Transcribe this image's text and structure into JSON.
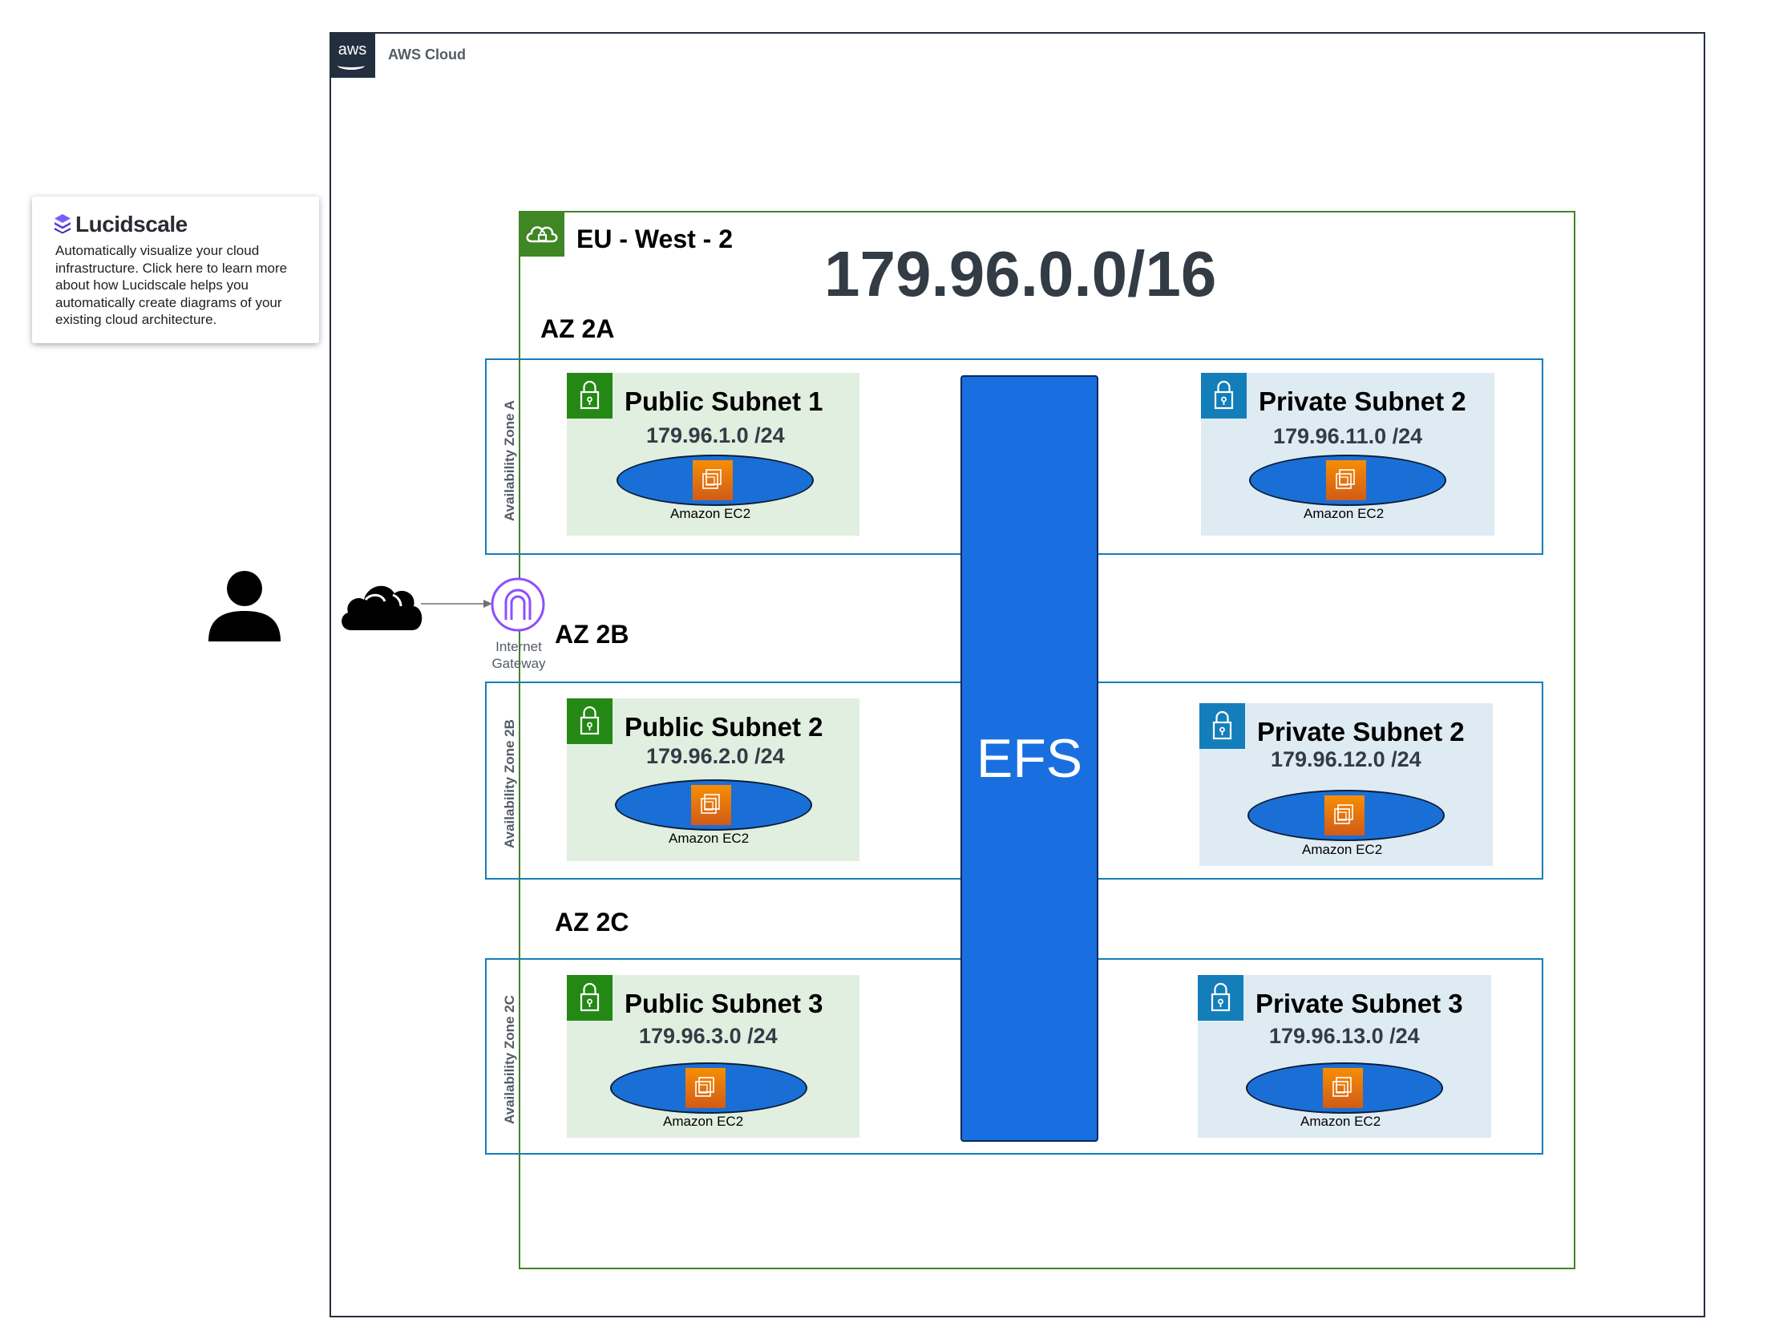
{
  "aws_cloud": {
    "label": "AWS Cloud",
    "logo_text": "aws"
  },
  "region": {
    "label": "EU - West - 2",
    "cidr": "179.96.0.0/16"
  },
  "lucidscale": {
    "name": "Lucidscale",
    "description": "Automatically visualize your cloud infrastructure. Click here to learn more about how Lucidscale helps you automatically create diagrams of your existing cloud architecture."
  },
  "internet_gateway": {
    "label": "Internet Gateway"
  },
  "efs": {
    "label": "EFS"
  },
  "zones": [
    {
      "az_label": "AZ 2A",
      "zone_label": "Availability Zone A",
      "public": {
        "title": "Public Subnet 1",
        "cidr": "179.96.1.0 /24",
        "ec2": "Amazon EC2"
      },
      "private": {
        "title": "Private Subnet 2",
        "cidr": "179.96.11.0 /24",
        "ec2": "Amazon EC2"
      }
    },
    {
      "az_label": "AZ 2B",
      "zone_label": "Availability Zone 2B",
      "public": {
        "title": "Public Subnet 2",
        "cidr": "179.96.2.0 /24",
        "ec2": "Amazon EC2"
      },
      "private": {
        "title": "Private Subnet 2",
        "cidr": "179.96.12.0 /24",
        "ec2": "Amazon EC2"
      }
    },
    {
      "az_label": "AZ 2C",
      "zone_label": "Availability Zone 2C",
      "public": {
        "title": "Public Subnet 3",
        "cidr": "179.96.3.0 /24",
        "ec2": "Amazon EC2"
      },
      "private": {
        "title": "Private Subnet 3",
        "cidr": "179.96.13.0 /24",
        "ec2": "Amazon EC2"
      }
    }
  ],
  "colors": {
    "aws_dark": "#232f3e",
    "region_green": "#3f8624",
    "public_subnet_bg": "#e1efe0",
    "private_subnet_bg": "#dfebf3",
    "az_border": "#147eba",
    "efs_blue": "#1a6fe0",
    "gateway_purple": "#8c4fff",
    "ec2_orange": "#f78e04"
  }
}
